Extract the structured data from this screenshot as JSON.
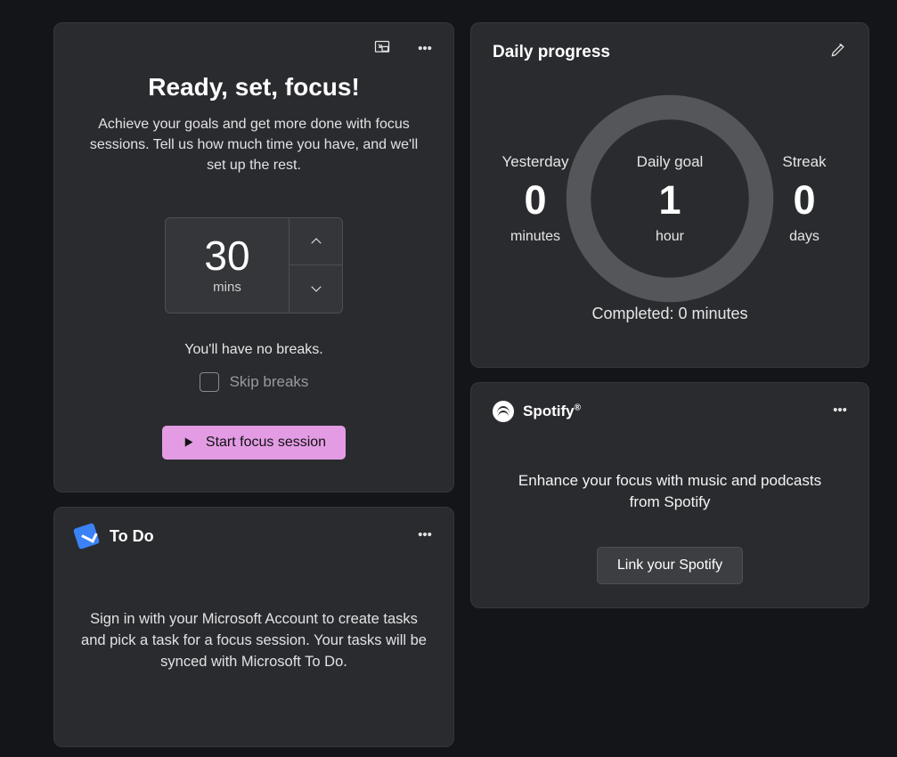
{
  "focus": {
    "title": "Ready, set, focus!",
    "subtitle": "Achieve your goals and get more done with focus sessions. Tell us how much time you have, and we'll set up the rest.",
    "minutes_value": "30",
    "minutes_unit": "mins",
    "breaks_text": "You'll have no breaks.",
    "skip_label": "Skip breaks",
    "start_label": "Start focus session"
  },
  "todo": {
    "title": "To Do",
    "message": "Sign in with your Microsoft Account to create tasks and pick a task for a focus session. Your tasks will be synced with Microsoft To Do."
  },
  "progress": {
    "title": "Daily progress",
    "yesterday": {
      "label": "Yesterday",
      "value": "0",
      "unit": "minutes"
    },
    "goal": {
      "label": "Daily goal",
      "value": "1",
      "unit": "hour"
    },
    "streak": {
      "label": "Streak",
      "value": "0",
      "unit": "days"
    },
    "completed": "Completed: 0 minutes"
  },
  "spotify": {
    "brand": "Spotify",
    "message": "Enhance your focus with music and podcasts from Spotify",
    "link_label": "Link your Spotify"
  }
}
